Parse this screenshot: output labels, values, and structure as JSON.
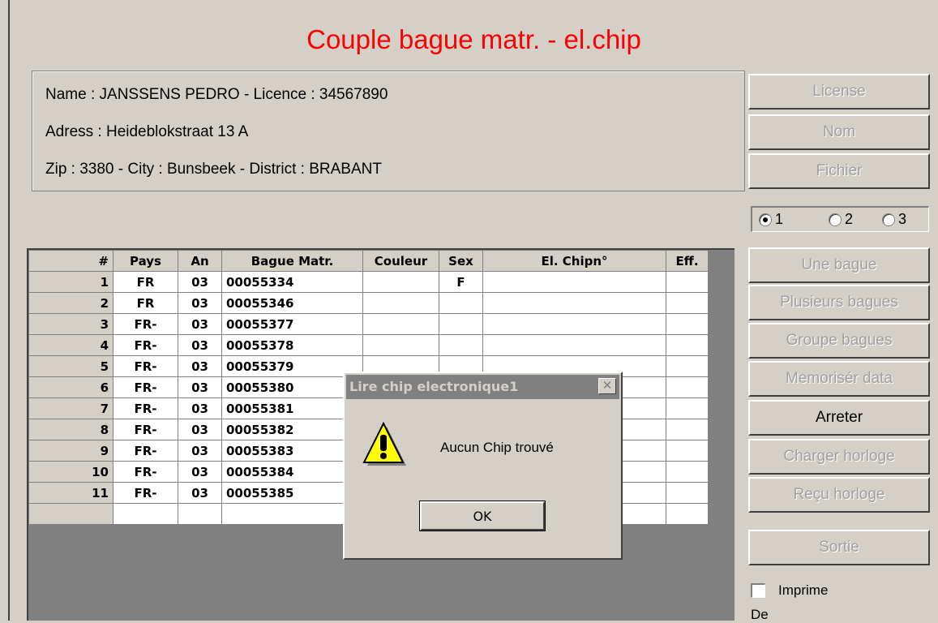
{
  "window": {
    "title": "Couple bague matr. - el.chip"
  },
  "owner": {
    "line1": "Name : JANSSENS PEDRO  - Licence : 34567890",
    "line2": "Adress : Heideblokstraat 13 A",
    "line3": "Zip : 3380  - City : Bunsbeek - District : BRABANT"
  },
  "search_buttons": {
    "license": "License",
    "nom": "Nom",
    "fichier": "Fichier"
  },
  "radio_options": [
    "1",
    "2",
    "3"
  ],
  "radio_selected": "1",
  "action_buttons": {
    "une_bague": "Une bague",
    "plusieurs_bagues": "Plusieurs bagues",
    "groupe_bagues": "Groupe bagues",
    "memoriser_data": "Memorisér data",
    "arreter": "Arreter",
    "charger_horloge": "Charger horloge",
    "recu_horloge": "Reçu horloge",
    "sortie": "Sortie"
  },
  "imprime": {
    "label": "Imprime",
    "checked": false
  },
  "de_label": "De",
  "grid": {
    "columns": [
      "#",
      "Pays",
      "An",
      "Bague Matr.",
      "Couleur",
      "Sex",
      "El. Chipn°",
      "Eff."
    ],
    "rows": [
      [
        "1",
        "FR",
        "03",
        "00055334",
        "",
        "F",
        "",
        ""
      ],
      [
        "2",
        "FR",
        "03",
        "00055346",
        "",
        "",
        "",
        ""
      ],
      [
        "3",
        "FR-",
        "03",
        "00055377",
        "",
        "",
        "",
        ""
      ],
      [
        "4",
        "FR-",
        "03",
        "00055378",
        "",
        "",
        "",
        ""
      ],
      [
        "5",
        "FR-",
        "03",
        "00055379",
        "",
        "",
        "",
        ""
      ],
      [
        "6",
        "FR-",
        "03",
        "00055380",
        "",
        "",
        "",
        ""
      ],
      [
        "7",
        "FR-",
        "03",
        "00055381",
        "",
        "",
        "",
        ""
      ],
      [
        "8",
        "FR-",
        "03",
        "00055382",
        "",
        "",
        "",
        ""
      ],
      [
        "9",
        "FR-",
        "03",
        "00055383",
        "",
        "",
        "",
        ""
      ],
      [
        "10",
        "FR-",
        "03",
        "00055384",
        "",
        "",
        "",
        ""
      ],
      [
        "11",
        "FR-",
        "03",
        "00055385",
        "",
        "",
        "",
        ""
      ],
      [
        "",
        "",
        "",
        "",
        "",
        "",
        "",
        ""
      ]
    ]
  },
  "dialog": {
    "title": "Lire chip electronique1",
    "message": "Aucun Chip trouvé",
    "ok_label": "OK",
    "icon": "warning-icon"
  },
  "colors": {
    "title": "#ff0000",
    "face": "#d4d0c8",
    "disabled_text": "#a0a0a0"
  }
}
